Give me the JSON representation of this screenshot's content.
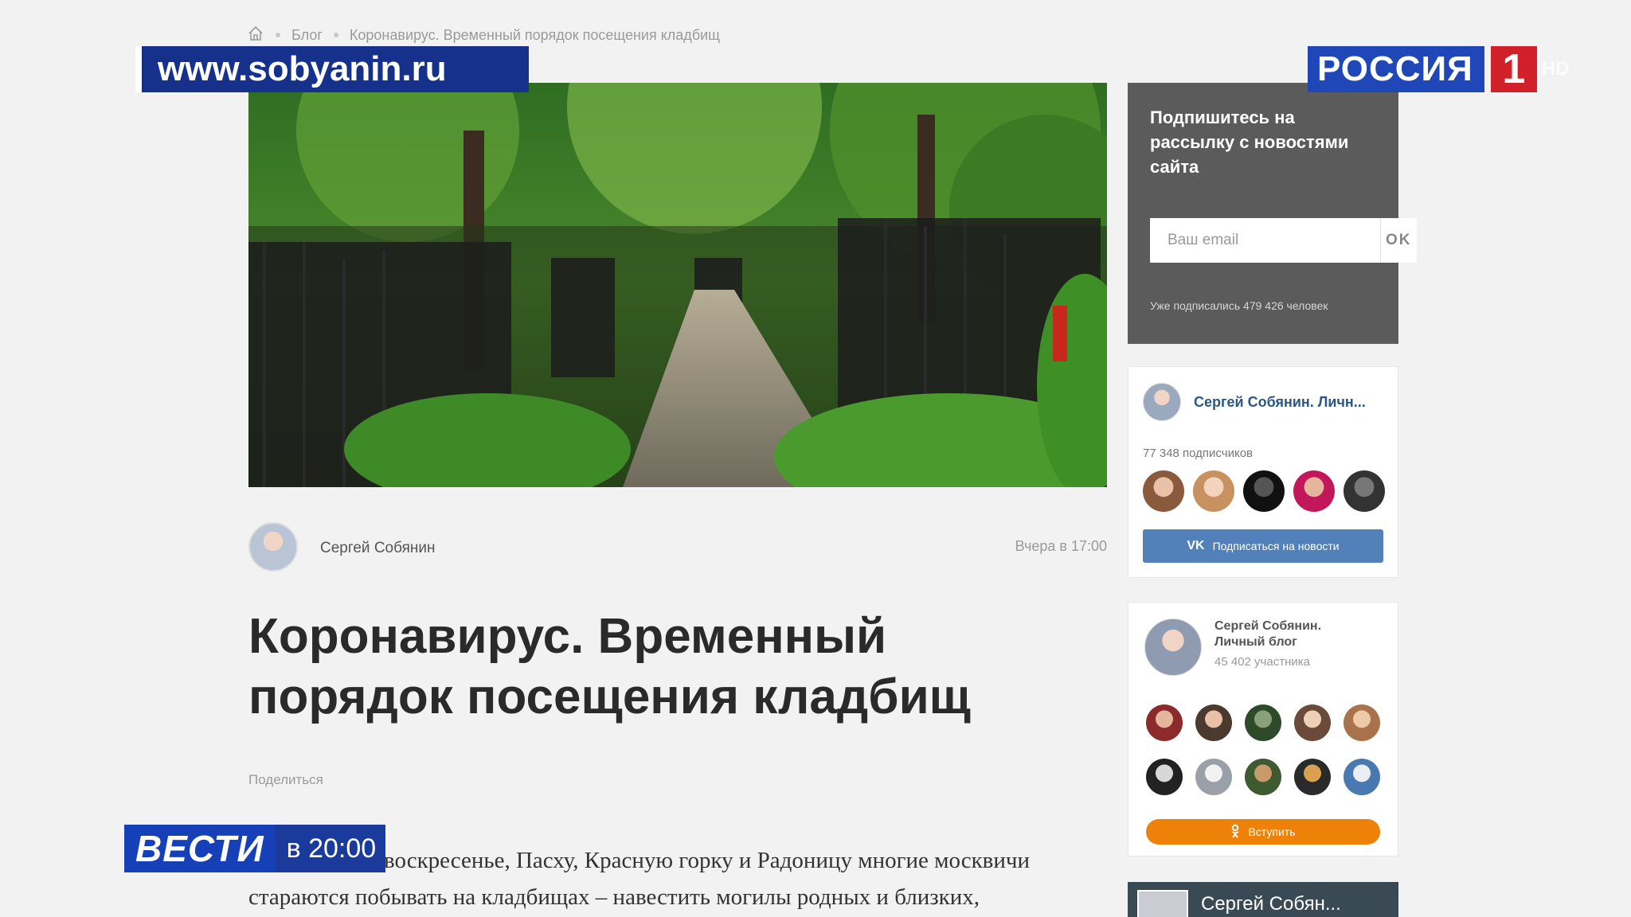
{
  "breadcrumb": {
    "items": [
      "Блог",
      "Коронавирус. Временный порядок посещения кладбищ"
    ]
  },
  "overlays": {
    "site_url": "www.sobyanin.ru",
    "channel_name": "РОССИЯ",
    "channel_number": "1",
    "channel_hd": "HD",
    "news_brand": "ВЕСТИ",
    "news_time": "в 20:00"
  },
  "article": {
    "author": "Сергей Собянин",
    "date": "Вчера в 17:00",
    "title": "Коронавирус. Временный порядок посещения кладбищ",
    "share_label": "Поделиться",
    "body": "воскресенье, Пасху, Красную горку и Радоницу многие москвичи стараются побывать на кладбищах – навестить могилы родных и близких,"
  },
  "sidebar": {
    "subscribe": {
      "title": "Подпишитесь на рассылку с новостями сайта",
      "email_placeholder": "Ваш email",
      "ok_label": "OK",
      "count_text": "Уже подписались 479 426 человек"
    },
    "vk": {
      "title": "Сергей Собянин. Личн...",
      "subscribers": "77 348 подписчиков",
      "button_label": "Подписаться на новости",
      "vk_logo": "VK"
    },
    "ok": {
      "title": "Сергей Собянин. Личный блог",
      "members": "45 402 участника",
      "button_label": "Вступить"
    },
    "fb": {
      "name": "Сергей Собян..."
    }
  },
  "colors": {
    "page_bg": "#f2f2f2",
    "site_overlay_bg": "#16318c",
    "channel_blue": "#1f47b8",
    "channel_red": "#d1202a",
    "vk_blue": "#5181b8",
    "ok_orange": "#ee8208",
    "subscribe_bg": "#5b5b5b"
  }
}
